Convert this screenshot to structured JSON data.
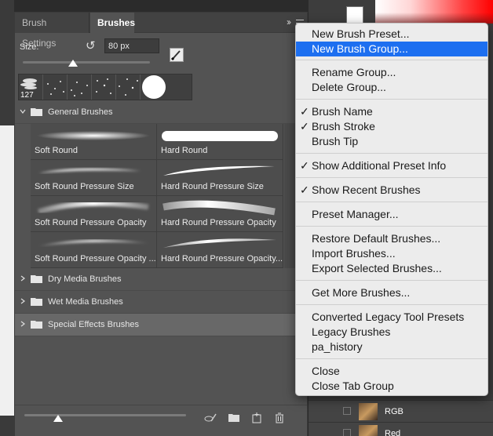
{
  "panel": {
    "tabs": [
      {
        "label": "Brush Settings"
      },
      {
        "label": "Brushes"
      }
    ],
    "collapse_glyph": "››",
    "size_label": "Size:",
    "size_value": "80 px",
    "recent_label": "127"
  },
  "groups": {
    "general": "General Brushes",
    "dry": "Dry Media Brushes",
    "wet": "Wet Media Brushes",
    "special": "Special Effects Brushes"
  },
  "brushes": [
    {
      "name": "Soft Round",
      "stroke": "soft-round"
    },
    {
      "name": "Hard Round",
      "stroke": "hard-round"
    },
    {
      "name": "Soft Round Pressure Size",
      "stroke": "soft-size"
    },
    {
      "name": "Hard Round Pressure Size",
      "stroke": "hard-size"
    },
    {
      "name": "Soft Round Pressure Opacity",
      "stroke": "soft-opacity"
    },
    {
      "name": "Hard Round Pressure Opacity",
      "stroke": "hard-opacity"
    },
    {
      "name": "Soft Round Pressure Opacity ...",
      "stroke": "soft-opacity-size"
    },
    {
      "name": "Hard Round Pressure Opacity...",
      "stroke": "hard-opacity-size"
    }
  ],
  "layers": [
    {
      "name": "RGB"
    },
    {
      "name": "Red"
    }
  ],
  "menu": {
    "items": [
      {
        "label": "New Brush Preset...",
        "checked": false,
        "selected": false
      },
      {
        "label": "New Brush Group...",
        "checked": false,
        "selected": true
      },
      {
        "label": "Rename Group...",
        "checked": false,
        "selected": false
      },
      {
        "label": "Delete Group...",
        "checked": false,
        "selected": false
      },
      {
        "label": "Brush Name",
        "checked": true,
        "selected": false
      },
      {
        "label": "Brush Stroke",
        "checked": true,
        "selected": false
      },
      {
        "label": "Brush Tip",
        "checked": false,
        "selected": false
      },
      {
        "label": "Show Additional Preset Info",
        "checked": true,
        "selected": false
      },
      {
        "label": "Show Recent Brushes",
        "checked": true,
        "selected": false
      },
      {
        "label": "Preset Manager...",
        "checked": false,
        "selected": false
      },
      {
        "label": "Restore Default Brushes...",
        "checked": false,
        "selected": false
      },
      {
        "label": "Import Brushes...",
        "checked": false,
        "selected": false
      },
      {
        "label": "Export Selected Brushes...",
        "checked": false,
        "selected": false
      },
      {
        "label": "Get More Brushes...",
        "checked": false,
        "selected": false
      },
      {
        "label": "Converted Legacy Tool Presets",
        "checked": false,
        "selected": false
      },
      {
        "label": "Legacy Brushes",
        "checked": false,
        "selected": false
      },
      {
        "label": "pa_history",
        "checked": false,
        "selected": false
      },
      {
        "label": "Close",
        "checked": false,
        "selected": false
      },
      {
        "label": "Close Tab Group",
        "checked": false,
        "selected": false
      }
    ],
    "check_glyph": "✓"
  },
  "colors": {
    "panel_bg": "#535353",
    "menu_bg": "#ececec",
    "menu_highlight": "#1d6ff0"
  }
}
